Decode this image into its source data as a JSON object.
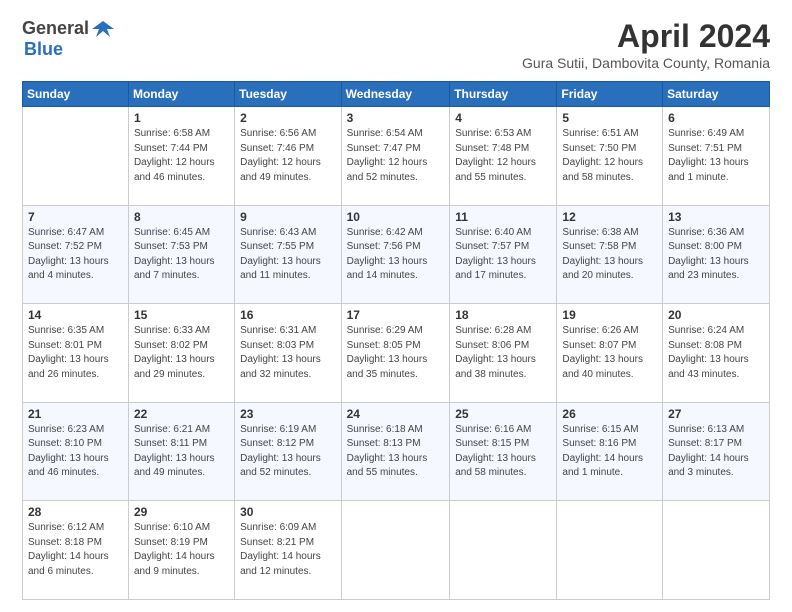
{
  "header": {
    "logo_general": "General",
    "logo_blue": "Blue",
    "title": "April 2024",
    "subtitle": "Gura Sutii, Dambovita County, Romania"
  },
  "calendar": {
    "headers": [
      "Sunday",
      "Monday",
      "Tuesday",
      "Wednesday",
      "Thursday",
      "Friday",
      "Saturday"
    ],
    "weeks": [
      [
        {
          "day": "",
          "info": ""
        },
        {
          "day": "1",
          "info": "Sunrise: 6:58 AM\nSunset: 7:44 PM\nDaylight: 12 hours\nand 46 minutes."
        },
        {
          "day": "2",
          "info": "Sunrise: 6:56 AM\nSunset: 7:46 PM\nDaylight: 12 hours\nand 49 minutes."
        },
        {
          "day": "3",
          "info": "Sunrise: 6:54 AM\nSunset: 7:47 PM\nDaylight: 12 hours\nand 52 minutes."
        },
        {
          "day": "4",
          "info": "Sunrise: 6:53 AM\nSunset: 7:48 PM\nDaylight: 12 hours\nand 55 minutes."
        },
        {
          "day": "5",
          "info": "Sunrise: 6:51 AM\nSunset: 7:50 PM\nDaylight: 12 hours\nand 58 minutes."
        },
        {
          "day": "6",
          "info": "Sunrise: 6:49 AM\nSunset: 7:51 PM\nDaylight: 13 hours\nand 1 minute."
        }
      ],
      [
        {
          "day": "7",
          "info": "Sunrise: 6:47 AM\nSunset: 7:52 PM\nDaylight: 13 hours\nand 4 minutes."
        },
        {
          "day": "8",
          "info": "Sunrise: 6:45 AM\nSunset: 7:53 PM\nDaylight: 13 hours\nand 7 minutes."
        },
        {
          "day": "9",
          "info": "Sunrise: 6:43 AM\nSunset: 7:55 PM\nDaylight: 13 hours\nand 11 minutes."
        },
        {
          "day": "10",
          "info": "Sunrise: 6:42 AM\nSunset: 7:56 PM\nDaylight: 13 hours\nand 14 minutes."
        },
        {
          "day": "11",
          "info": "Sunrise: 6:40 AM\nSunset: 7:57 PM\nDaylight: 13 hours\nand 17 minutes."
        },
        {
          "day": "12",
          "info": "Sunrise: 6:38 AM\nSunset: 7:58 PM\nDaylight: 13 hours\nand 20 minutes."
        },
        {
          "day": "13",
          "info": "Sunrise: 6:36 AM\nSunset: 8:00 PM\nDaylight: 13 hours\nand 23 minutes."
        }
      ],
      [
        {
          "day": "14",
          "info": "Sunrise: 6:35 AM\nSunset: 8:01 PM\nDaylight: 13 hours\nand 26 minutes."
        },
        {
          "day": "15",
          "info": "Sunrise: 6:33 AM\nSunset: 8:02 PM\nDaylight: 13 hours\nand 29 minutes."
        },
        {
          "day": "16",
          "info": "Sunrise: 6:31 AM\nSunset: 8:03 PM\nDaylight: 13 hours\nand 32 minutes."
        },
        {
          "day": "17",
          "info": "Sunrise: 6:29 AM\nSunset: 8:05 PM\nDaylight: 13 hours\nand 35 minutes."
        },
        {
          "day": "18",
          "info": "Sunrise: 6:28 AM\nSunset: 8:06 PM\nDaylight: 13 hours\nand 38 minutes."
        },
        {
          "day": "19",
          "info": "Sunrise: 6:26 AM\nSunset: 8:07 PM\nDaylight: 13 hours\nand 40 minutes."
        },
        {
          "day": "20",
          "info": "Sunrise: 6:24 AM\nSunset: 8:08 PM\nDaylight: 13 hours\nand 43 minutes."
        }
      ],
      [
        {
          "day": "21",
          "info": "Sunrise: 6:23 AM\nSunset: 8:10 PM\nDaylight: 13 hours\nand 46 minutes."
        },
        {
          "day": "22",
          "info": "Sunrise: 6:21 AM\nSunset: 8:11 PM\nDaylight: 13 hours\nand 49 minutes."
        },
        {
          "day": "23",
          "info": "Sunrise: 6:19 AM\nSunset: 8:12 PM\nDaylight: 13 hours\nand 52 minutes."
        },
        {
          "day": "24",
          "info": "Sunrise: 6:18 AM\nSunset: 8:13 PM\nDaylight: 13 hours\nand 55 minutes."
        },
        {
          "day": "25",
          "info": "Sunrise: 6:16 AM\nSunset: 8:15 PM\nDaylight: 13 hours\nand 58 minutes."
        },
        {
          "day": "26",
          "info": "Sunrise: 6:15 AM\nSunset: 8:16 PM\nDaylight: 14 hours\nand 1 minute."
        },
        {
          "day": "27",
          "info": "Sunrise: 6:13 AM\nSunset: 8:17 PM\nDaylight: 14 hours\nand 3 minutes."
        }
      ],
      [
        {
          "day": "28",
          "info": "Sunrise: 6:12 AM\nSunset: 8:18 PM\nDaylight: 14 hours\nand 6 minutes."
        },
        {
          "day": "29",
          "info": "Sunrise: 6:10 AM\nSunset: 8:19 PM\nDaylight: 14 hours\nand 9 minutes."
        },
        {
          "day": "30",
          "info": "Sunrise: 6:09 AM\nSunset: 8:21 PM\nDaylight: 14 hours\nand 12 minutes."
        },
        {
          "day": "",
          "info": ""
        },
        {
          "day": "",
          "info": ""
        },
        {
          "day": "",
          "info": ""
        },
        {
          "day": "",
          "info": ""
        }
      ]
    ]
  }
}
